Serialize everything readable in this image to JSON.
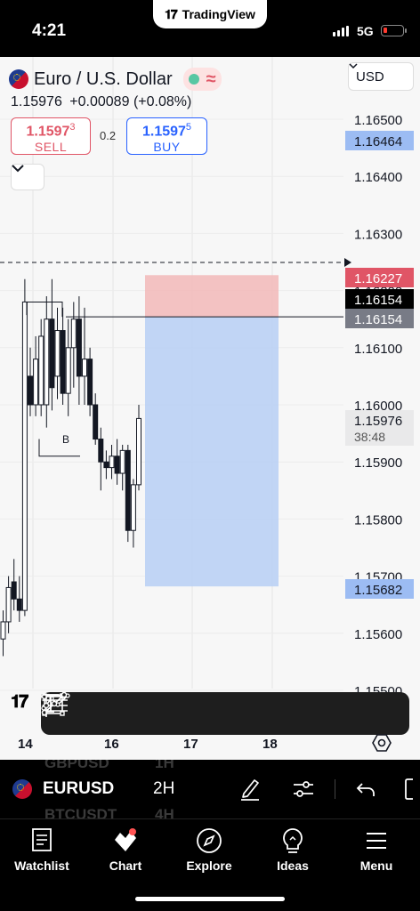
{
  "status_bar": {
    "time": "4:21",
    "app_label": "TradingView",
    "network": "5G"
  },
  "symbol_header": {
    "title": "Euro / U.S. Dollar",
    "last_price": "1.15976",
    "change": "+0.00089",
    "change_pct": "(+0.08%)"
  },
  "trade": {
    "sell_price_main": "1.1597",
    "sell_price_pip": "3",
    "sell_label": "SELL",
    "spread": "0.2",
    "buy_price_main": "1.1597",
    "buy_price_pip": "5",
    "buy_label": "BUY"
  },
  "currency_select": {
    "value": "USD"
  },
  "price_axis": {
    "ticks": [
      "1.16500",
      "1.16400",
      "1.16300",
      "1.16200",
      "1.16100",
      "1.16000",
      "1.15900",
      "1.15800",
      "1.15700",
      "1.15600",
      "1.15500"
    ],
    "labels": {
      "target": "1.16464",
      "stop": "1.16227",
      "marker": "1.16154",
      "entry": "1.16154",
      "current": "1.15976",
      "countdown": "38:48",
      "lower_target": "1.15682"
    }
  },
  "chart_annotations": {
    "level_label": "B"
  },
  "colors": {
    "stop_zone": "#f2b8b8",
    "profit_zone": "#b7cff5",
    "target_label": "#9cbcf3",
    "stop_label": "#e05566",
    "entry_label": "#787b86",
    "marker_label": "#000000"
  },
  "x_axis": {
    "labels": [
      "14",
      "16",
      "17",
      "18"
    ]
  },
  "drawing_toolbar": {
    "tools": [
      "drag-handle-icon",
      "rectangle-icon",
      "fib-lines-icon",
      "path-icon",
      "horizontal-ray-icon",
      "trend-line-icon",
      "text-icon",
      "info-line-icon",
      "vertical-line-icon"
    ]
  },
  "symbol_toolbar": {
    "symbol": "EURUSD",
    "interval": "2H",
    "ghost_above": [
      "GBPUSD",
      "1H"
    ],
    "ghost_below": [
      "BTCUSDT",
      "4H"
    ]
  },
  "nav": {
    "items": [
      {
        "label": "Watchlist",
        "icon": "watchlist-icon"
      },
      {
        "label": "Chart",
        "icon": "chart-icon"
      },
      {
        "label": "Explore",
        "icon": "compass-icon"
      },
      {
        "label": "Ideas",
        "icon": "lightbulb-icon"
      },
      {
        "label": "Menu",
        "icon": "menu-icon"
      }
    ]
  },
  "chart_data": {
    "type": "candlestick",
    "symbol": "EURUSD",
    "interval": "2H",
    "ylim": [
      1.1548,
      1.1658
    ],
    "x_tick_labels": [
      "14",
      "16",
      "17",
      "18"
    ],
    "candles": [
      {
        "o": 1.1559,
        "h": 1.1564,
        "l": 1.1556,
        "c": 1.1562
      },
      {
        "o": 1.1562,
        "h": 1.157,
        "l": 1.156,
        "c": 1.1568
      },
      {
        "o": 1.1569,
        "h": 1.1573,
        "l": 1.1564,
        "c": 1.1566
      },
      {
        "o": 1.1566,
        "h": 1.157,
        "l": 1.1562,
        "c": 1.1564
      },
      {
        "o": 1.1564,
        "h": 1.1622,
        "l": 1.1563,
        "c": 1.1618
      },
      {
        "o": 1.1605,
        "h": 1.161,
        "l": 1.1598,
        "c": 1.16
      },
      {
        "o": 1.16,
        "h": 1.1612,
        "l": 1.1598,
        "c": 1.1608
      },
      {
        "o": 1.16,
        "h": 1.1615,
        "l": 1.1598,
        "c": 1.1612
      },
      {
        "o": 1.16,
        "h": 1.1619,
        "l": 1.1596,
        "c": 1.1615
      },
      {
        "o": 1.1615,
        "h": 1.1622,
        "l": 1.1599,
        "c": 1.1603
      },
      {
        "o": 1.1605,
        "h": 1.1617,
        "l": 1.1601,
        "c": 1.1613
      },
      {
        "o": 1.1613,
        "h": 1.1617,
        "l": 1.16,
        "c": 1.1602
      },
      {
        "o": 1.1602,
        "h": 1.1615,
        "l": 1.1598,
        "c": 1.161
      },
      {
        "o": 1.161,
        "h": 1.1618,
        "l": 1.1603,
        "c": 1.1615
      },
      {
        "o": 1.1615,
        "h": 1.1619,
        "l": 1.16,
        "c": 1.1605
      },
      {
        "o": 1.1605,
        "h": 1.1617,
        "l": 1.16,
        "c": 1.1608
      },
      {
        "o": 1.1608,
        "h": 1.161,
        "l": 1.1598,
        "c": 1.16
      },
      {
        "o": 1.16,
        "h": 1.1602,
        "l": 1.1593,
        "c": 1.1594
      },
      {
        "o": 1.1594,
        "h": 1.1596,
        "l": 1.1585,
        "c": 1.159
      },
      {
        "o": 1.159,
        "h": 1.1592,
        "l": 1.1587,
        "c": 1.1589
      },
      {
        "o": 1.1589,
        "h": 1.1593,
        "l": 1.1587,
        "c": 1.1591
      },
      {
        "o": 1.1591,
        "h": 1.1594,
        "l": 1.1586,
        "c": 1.1588
      },
      {
        "o": 1.1588,
        "h": 1.1593,
        "l": 1.1585,
        "c": 1.1592
      },
      {
        "o": 1.1592,
        "h": 1.1593,
        "l": 1.1576,
        "c": 1.1578
      },
      {
        "o": 1.1578,
        "h": 1.1587,
        "l": 1.1575,
        "c": 1.1586
      },
      {
        "o": 1.1586,
        "h": 1.16,
        "l": 1.1585,
        "c": 1.15976
      }
    ],
    "position": {
      "entry": 1.16154,
      "stop": 1.16227,
      "target": 1.15682
    },
    "current_price": 1.15976
  }
}
